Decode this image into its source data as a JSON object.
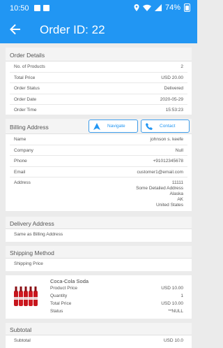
{
  "status_bar": {
    "time": "10:50",
    "battery": "74%"
  },
  "app_bar": {
    "title": "Order ID: 22"
  },
  "order_details": {
    "heading": "Order Details",
    "rows": [
      {
        "label": "No. of Products",
        "value": "2"
      },
      {
        "label": "Total Price",
        "value": "USD 20.00"
      },
      {
        "label": "Order Status",
        "value": "Delivered"
      },
      {
        "label": "Order Date",
        "value": "2020-05-29"
      },
      {
        "label": "Order Time",
        "value": "15:53:23"
      }
    ]
  },
  "billing": {
    "heading": "Billing Address",
    "navigate_label": "Navigate",
    "contact_label": "Contact",
    "rows": [
      {
        "label": "Name",
        "value": "johnson s. keefe"
      },
      {
        "label": "Company",
        "value": "Null"
      },
      {
        "label": "Phone",
        "value": "+91012345678"
      },
      {
        "label": "Email",
        "value": "customer1@email.com"
      }
    ],
    "address_label": "Address",
    "address_lines": [
      "11111",
      "Some Detailed Address",
      "Alaska",
      "AK",
      "United States"
    ]
  },
  "delivery": {
    "heading": "Delivery Address",
    "text": "Same as Billing Address"
  },
  "shipping": {
    "heading": "Shipping Method",
    "text": "Shipping Price"
  },
  "product": {
    "name": "Coca-Cola Soda",
    "rows": [
      {
        "label": "Product Price",
        "value": "USD 10.00"
      },
      {
        "label": "Quantity",
        "value": "1"
      },
      {
        "label": "Total Price",
        "value": "USD 10.00"
      },
      {
        "label": "Status",
        "value": "**NULL"
      }
    ]
  },
  "subtotal": {
    "heading": "Subtotal",
    "label": "Subtotal",
    "value": "USD 10.0"
  },
  "colors": {
    "primary": "#2196f3",
    "background": "#ebebeb",
    "card": "#ffffff"
  }
}
